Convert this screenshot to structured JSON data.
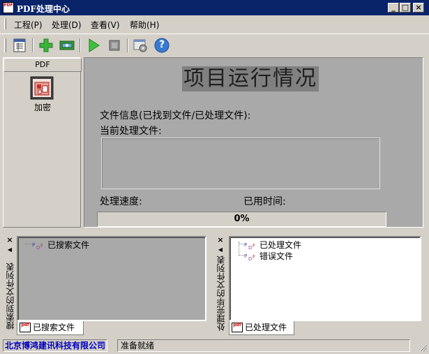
{
  "window": {
    "title": "PDF处理中心",
    "app_icon_text": "PDF",
    "minimize": "_",
    "maximize": "□",
    "close": "×"
  },
  "menu": {
    "items": [
      {
        "label": "工程(P)"
      },
      {
        "label": "处理(D)"
      },
      {
        "label": "查看(V)"
      },
      {
        "label": "帮助(H)"
      }
    ]
  },
  "toolbar": {
    "buttons": [
      "list-icon",
      "add-icon",
      "display-icon",
      "play-icon",
      "stop-icon",
      "settings-icon",
      "help-icon"
    ],
    "help_glyph": "?"
  },
  "left_panel": {
    "header": "PDF",
    "tool_label": "加密"
  },
  "main": {
    "title": "项目运行情况",
    "file_info_label": "文件信息(已找到文件/已处理文件):",
    "current_file_label": "当前处理文件:",
    "speed_label": "处理速度:",
    "elapsed_label": "已用时间:",
    "progress_text": "0%",
    "progress_value": 0
  },
  "search_dock": {
    "vertical_title": "搜索到的文件列表",
    "close": "×",
    "arrow": "◀",
    "tree": [
      {
        "label": "已搜索文件"
      }
    ],
    "tab_label": "已搜索文件",
    "tab_icon_text": "pdf"
  },
  "done_dock": {
    "vertical_title": "处理完毕的文件列表",
    "close": "×",
    "arrow": "◀",
    "tree": [
      {
        "label": "已处理文件"
      },
      {
        "label": "错误文件"
      }
    ],
    "tab_label": "已处理文件",
    "tab_icon_text": "pdf"
  },
  "statusbar": {
    "company": "北京博鸿建讯科技有限公司",
    "status": "准备就绪"
  },
  "colors": {
    "titlebar": "#0a246a",
    "face": "#d4d0c8",
    "main_bg": "#a9a9a9",
    "company_text": "#0000c0"
  }
}
